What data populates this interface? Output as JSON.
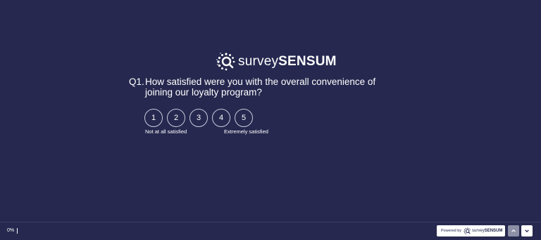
{
  "brand": {
    "name_light": "survey",
    "name_bold": "SENSUM"
  },
  "question": {
    "number": "Q1.",
    "text": "How satisfied were you with the overall convenience of joining our loyalty program?"
  },
  "rating": {
    "options": [
      "1",
      "2",
      "3",
      "4",
      "5"
    ],
    "low_label": "Not at all satisfied",
    "high_label": "Extremely satisfied"
  },
  "footer": {
    "progress_text": "0%",
    "progress_value": 0,
    "powered_by": "Powered by",
    "brand_light": "survey",
    "brand_bold": "SENSUM",
    "nav_up_icon": "chevron-up-icon",
    "nav_down_icon": "chevron-down-icon"
  },
  "colors": {
    "background": "#26284f",
    "text": "#ffffff",
    "nav_up_bg": "#8d8fa6",
    "nav_down_bg": "#ffffff"
  }
}
